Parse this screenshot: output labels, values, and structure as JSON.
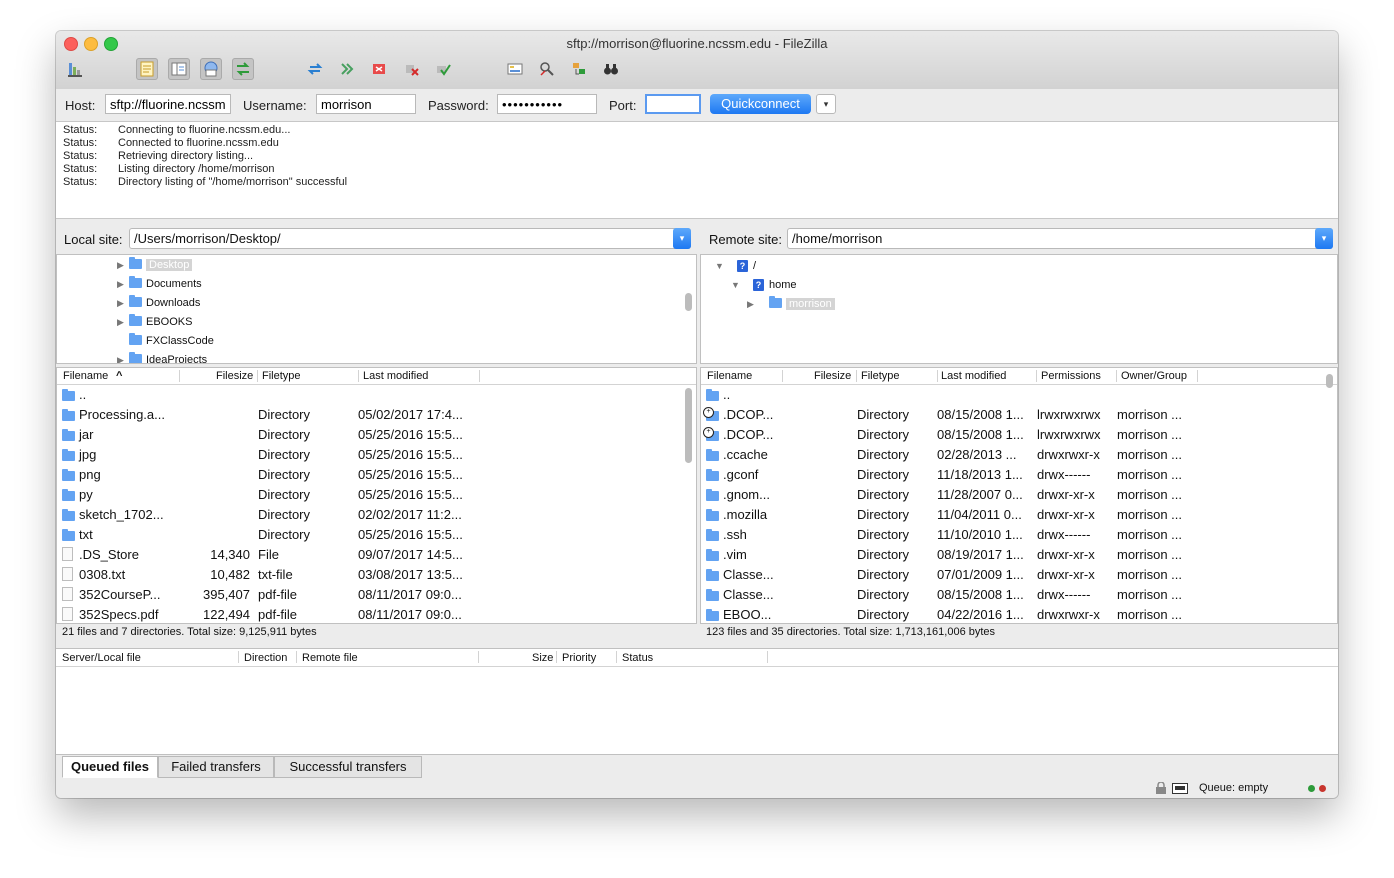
{
  "window": {
    "title": "sftp://morrison@fluorine.ncssm.edu - FileZilla"
  },
  "toolbar": {
    "icons": [
      "site-manager-icon",
      "toggle-log-icon",
      "toggle-tree-icon",
      "toggle-remote-tree-icon",
      "toggle-queue-icon",
      "refresh-icon",
      "process-queue-icon",
      "cancel-icon",
      "disconnect-icon",
      "reconnect-icon",
      "compare-icon",
      "sync-browse-icon",
      "search-icon",
      "find-icon"
    ]
  },
  "quickconnect": {
    "host_label": "Host:",
    "host_value": "sftp://fluorine.ncssm.edu",
    "username_label": "Username:",
    "username_value": "morrison",
    "password_label": "Password:",
    "password_value": "•••••••••••",
    "port_label": "Port:",
    "port_value": "",
    "button_label": "Quickconnect",
    "dropdown_glyph": "▾"
  },
  "log": [
    {
      "label": "Status:",
      "text": "Connecting to fluorine.ncssm.edu..."
    },
    {
      "label": "Status:",
      "text": "Connected to fluorine.ncssm.edu"
    },
    {
      "label": "Status:",
      "text": "Retrieving directory listing..."
    },
    {
      "label": "Status:",
      "text": "Listing directory /home/morrison"
    },
    {
      "label": "Status:",
      "text": "Directory listing of \"/home/morrison\" successful"
    }
  ],
  "local": {
    "label": "Local site:",
    "path": "/Users/morrison/Desktop/",
    "tree": [
      {
        "name": "Desktop",
        "expandable": true,
        "selected": true
      },
      {
        "name": "Documents",
        "expandable": true,
        "selected": false
      },
      {
        "name": "Downloads",
        "expandable": true,
        "selected": false
      },
      {
        "name": "EBOOKS",
        "expandable": true,
        "selected": false
      },
      {
        "name": "FXClassCode",
        "expandable": false,
        "selected": false
      },
      {
        "name": "IdeaProjects",
        "expandable": true,
        "selected": false
      }
    ],
    "columns": {
      "filename": "Filename",
      "sort_glyph": "^",
      "filesize": "Filesize",
      "filetype": "Filetype",
      "modified": "Last modified"
    },
    "files": [
      {
        "name": "..",
        "size": "",
        "type": "",
        "modified": "",
        "kind": "folder"
      },
      {
        "name": "Processing.a...",
        "size": "",
        "type": "Directory",
        "modified": "05/02/2017 17:4...",
        "kind": "folder"
      },
      {
        "name": "jar",
        "size": "",
        "type": "Directory",
        "modified": "05/25/2016 15:5...",
        "kind": "folder"
      },
      {
        "name": "jpg",
        "size": "",
        "type": "Directory",
        "modified": "05/25/2016 15:5...",
        "kind": "folder"
      },
      {
        "name": "png",
        "size": "",
        "type": "Directory",
        "modified": "05/25/2016 15:5...",
        "kind": "folder"
      },
      {
        "name": "py",
        "size": "",
        "type": "Directory",
        "modified": "05/25/2016 15:5...",
        "kind": "folder"
      },
      {
        "name": "sketch_1702...",
        "size": "",
        "type": "Directory",
        "modified": "02/02/2017 11:2...",
        "kind": "folder"
      },
      {
        "name": "txt",
        "size": "",
        "type": "Directory",
        "modified": "05/25/2016 15:5...",
        "kind": "folder"
      },
      {
        "name": ".DS_Store",
        "size": "14,340",
        "type": "File",
        "modified": "09/07/2017 14:5...",
        "kind": "file"
      },
      {
        "name": "0308.txt",
        "size": "10,482",
        "type": "txt-file",
        "modified": "03/08/2017 13:5...",
        "kind": "file"
      },
      {
        "name": "352CourseP...",
        "size": "395,407",
        "type": "pdf-file",
        "modified": "08/11/2017 09:0...",
        "kind": "file"
      },
      {
        "name": "352Specs.pdf",
        "size": "122,494",
        "type": "pdf-file",
        "modified": "08/11/2017 09:0...",
        "kind": "file"
      }
    ],
    "summary": "21 files and 7 directories. Total size: 9,125,911 bytes"
  },
  "remote": {
    "label": "Remote site:",
    "path": "/home/morrison",
    "tree": [
      {
        "name": "/",
        "icon": "?",
        "level": 0
      },
      {
        "name": "home",
        "icon": "?",
        "level": 1
      },
      {
        "name": "morrison",
        "icon": "folder",
        "level": 2,
        "selected": true
      }
    ],
    "columns": {
      "filename": "Filename",
      "filesize": "Filesize",
      "filetype": "Filetype",
      "modified": "Last modified",
      "permissions": "Permissions",
      "owner": "Owner/Group"
    },
    "files": [
      {
        "name": "..",
        "type": "",
        "modified": "",
        "perms": "",
        "owner": "",
        "link": false
      },
      {
        "name": ".DCOP...",
        "type": "Directory",
        "modified": "08/15/2008 1...",
        "perms": "lrwxrwxrwx",
        "owner": "morrison ...",
        "link": true
      },
      {
        "name": ".DCOP...",
        "type": "Directory",
        "modified": "08/15/2008 1...",
        "perms": "lrwxrwxrwx",
        "owner": "morrison ...",
        "link": true
      },
      {
        "name": ".ccache",
        "type": "Directory",
        "modified": "02/28/2013 ...",
        "perms": "drwxrwxr-x",
        "owner": "morrison ...",
        "link": false
      },
      {
        "name": ".gconf",
        "type": "Directory",
        "modified": "11/18/2013 1...",
        "perms": "drwx------",
        "owner": "morrison ...",
        "link": false
      },
      {
        "name": ".gnom...",
        "type": "Directory",
        "modified": "11/28/2007 0...",
        "perms": "drwxr-xr-x",
        "owner": "morrison ...",
        "link": false
      },
      {
        "name": ".mozilla",
        "type": "Directory",
        "modified": "11/04/2011 0...",
        "perms": "drwxr-xr-x",
        "owner": "morrison ...",
        "link": false
      },
      {
        "name": ".ssh",
        "type": "Directory",
        "modified": "11/10/2010 1...",
        "perms": "drwx------",
        "owner": "morrison ...",
        "link": false
      },
      {
        "name": ".vim",
        "type": "Directory",
        "modified": "08/19/2017 1...",
        "perms": "drwxr-xr-x",
        "owner": "morrison ...",
        "link": false
      },
      {
        "name": "Classe...",
        "type": "Directory",
        "modified": "07/01/2009 1...",
        "perms": "drwxr-xr-x",
        "owner": "morrison ...",
        "link": false
      },
      {
        "name": "Classe...",
        "type": "Directory",
        "modified": "08/15/2008 1...",
        "perms": "drwx------",
        "owner": "morrison ...",
        "link": false
      },
      {
        "name": "EBOO...",
        "type": "Directory",
        "modified": "04/22/2016 1...",
        "perms": "drwxrwxr-x",
        "owner": "morrison ...",
        "link": false
      }
    ],
    "summary": "123 files and 35 directories. Total size: 1,713,161,006 bytes"
  },
  "queue": {
    "columns": {
      "server": "Server/Local file",
      "direction": "Direction",
      "remote": "Remote file",
      "size": "Size",
      "priority": "Priority",
      "status": "Status"
    },
    "tabs": [
      "Queued files",
      "Failed transfers",
      "Successful transfers"
    ],
    "status_text": "Queue: empty"
  },
  "colors": {
    "accent": "#1d78f2",
    "folder": "#63a3f2",
    "selection": "#d4d4d4"
  }
}
